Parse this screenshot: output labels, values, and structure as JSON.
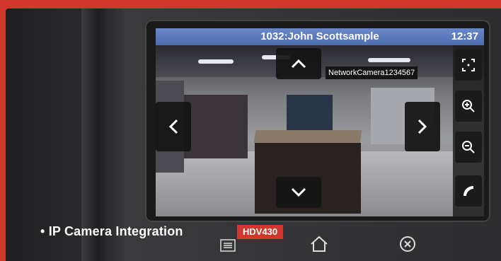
{
  "screen": {
    "title": "1032:John Scottsample",
    "time": "12:37",
    "camera_label": "NetworkCamera1234567"
  },
  "controls": {
    "up_icon": "chevron-up-icon",
    "down_icon": "chevron-down-icon",
    "left_icon": "chevron-left-icon",
    "right_icon": "chevron-right-icon",
    "fullscreen_icon": "fullscreen-icon",
    "zoom_in_icon": "zoom-in-icon",
    "zoom_out_icon": "zoom-out-icon",
    "call_icon": "phone-icon"
  },
  "softkeys": {
    "menu_icon": "menu-icon",
    "home_icon": "home-icon",
    "cancel_icon": "cancel-icon"
  },
  "caption": {
    "text": "• IP Camera Integration",
    "badge": "HDV430"
  },
  "colors": {
    "accent": "#d0382e",
    "titlebar": "#5577bb"
  }
}
